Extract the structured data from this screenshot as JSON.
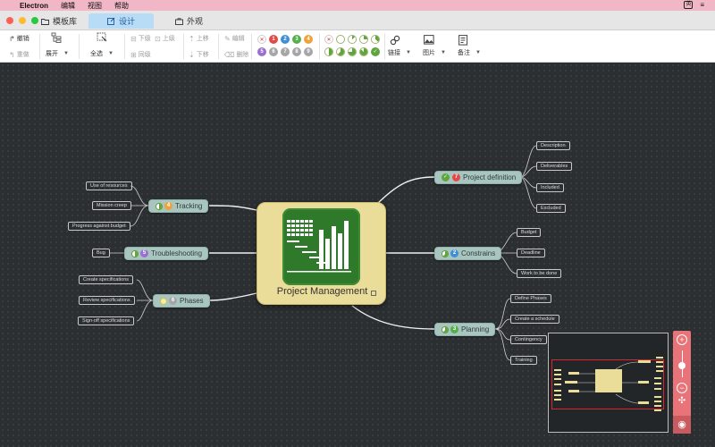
{
  "menubar": {
    "app": "Electron",
    "items": [
      "编辑",
      "视图",
      "帮助"
    ]
  },
  "tabs": [
    {
      "label": "模板库"
    },
    {
      "label": "设计"
    },
    {
      "label": "外观"
    }
  ],
  "toolbar": {
    "undo": "撤销",
    "redo": "重做",
    "expand": "展开",
    "select_all": "全选",
    "child": "下级",
    "parent": "上级",
    "sibling": "同级",
    "move_up": "上移",
    "move_down": "下移",
    "edit": "编辑",
    "delete": "删除",
    "link": "链接",
    "image": "图片",
    "note": "备注",
    "priorities": [
      "1",
      "2",
      "3",
      "4",
      "5",
      "6",
      "7",
      "8",
      "9"
    ]
  },
  "colors": {
    "canvas": "#2b2f31",
    "topic": "#a9c5bf",
    "root": "#eadd9a",
    "zoom_panel": "#e8747a",
    "active_tab": "#b9dcf6"
  },
  "mindmap": {
    "root": "Project Management",
    "topics": {
      "definition": {
        "label": "Project definition",
        "badge": "7",
        "subs": [
          "Description",
          "Deliverables",
          "Included",
          "Excluded"
        ]
      },
      "constrains": {
        "label": "Constrains",
        "badge": "2",
        "subs": [
          "Budget",
          "Deadline",
          "Work to be done"
        ]
      },
      "planning": {
        "label": "Planning",
        "badge": "3",
        "subs": [
          "Define Phases",
          "Create a schedule",
          "Contingency",
          "Training"
        ]
      },
      "tracking": {
        "label": "Tracking",
        "badge": "4",
        "subs": [
          "Use of resources",
          "Mission creep",
          "Progress against budget"
        ]
      },
      "troubleshooting": {
        "label": "Troubleshooting",
        "badge": "5",
        "subs": [
          "Bug"
        ]
      },
      "phases": {
        "label": "Phases",
        "badge": "6",
        "subs": [
          "Create specifications",
          "Review specifications",
          "Sign-off specifications"
        ]
      }
    }
  },
  "zoom": {
    "in": "+",
    "out": "−"
  }
}
